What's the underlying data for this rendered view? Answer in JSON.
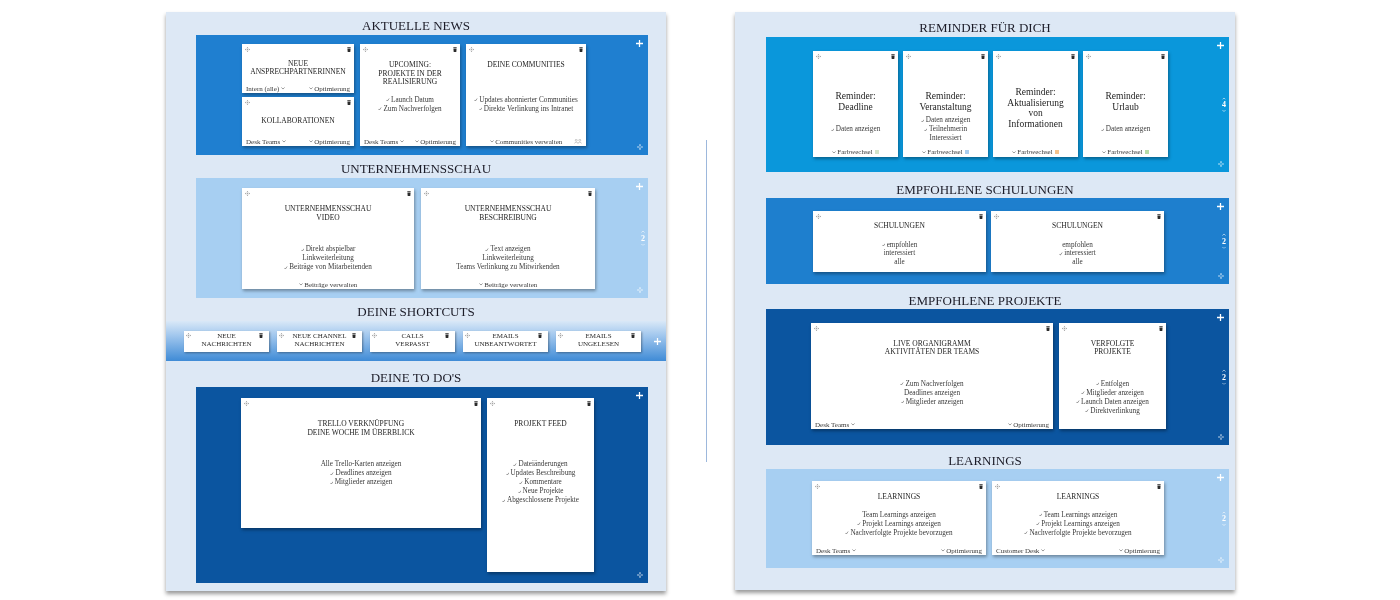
{
  "pages": [
    {
      "sections": [
        {
          "title": "AKTUELLE NEWS",
          "kind": "panel",
          "color": "#1f7fd0",
          "columns": [
            {
              "cards": [
                {
                  "title": "NEUE\nANSPRECHPARTNERINNEN",
                  "footer": {
                    "kind": "split",
                    "left": "Intern (alle)",
                    "right": "Optimierung"
                  }
                },
                {
                  "title": "KOLLABORATIONEN",
                  "footer": {
                    "kind": "split",
                    "left": "Desk Teams",
                    "right": "Optimierung"
                  }
                }
              ]
            },
            {
              "cards": [
                {
                  "title": "UPCOMING:\nPROJEKTE IN DER\nREALISIERUNG",
                  "options": [
                    {
                      "label": "Launch Datum",
                      "checked": true
                    },
                    {
                      "label": "Zum Nachverfolgen",
                      "checked": true
                    }
                  ],
                  "footer": {
                    "kind": "split",
                    "left": "Desk Teams",
                    "right": "Optimierung"
                  }
                }
              ]
            },
            {
              "cards": [
                {
                  "title": "DEINE COMMUNITIES",
                  "options": [
                    {
                      "label": "Updates abonnierter Communities",
                      "checked": true
                    },
                    {
                      "label": "Direkte Verlinkung ins Intranet",
                      "checked": true
                    }
                  ],
                  "footer": {
                    "kind": "members",
                    "center": "Communities verwalten"
                  }
                }
              ]
            }
          ]
        },
        {
          "title": "UNTERNEHMENSSCHAU",
          "kind": "panel",
          "color": "#a7cff2",
          "pager": "2",
          "columns": [
            {
              "cards": [
                {
                  "title": "UNTERNEHMENSSCHAU\nVIDEO",
                  "options": [
                    {
                      "label": "Direkt abspielbar",
                      "checked": true
                    },
                    {
                      "label": "Linkweiterleitung",
                      "checked": false
                    },
                    {
                      "label": "Beiträge von Mitarbeitenden",
                      "checked": true
                    }
                  ],
                  "footer": {
                    "kind": "action",
                    "center": "Beiträge verwalten"
                  }
                }
              ]
            },
            {
              "cards": [
                {
                  "title": "UNTERNEHMENSSCHAU\nBESCHREIBUNG",
                  "options": [
                    {
                      "label": "Text anzeigen",
                      "checked": true
                    },
                    {
                      "label": "Linkweiterleitung",
                      "checked": false
                    },
                    {
                      "label": "Teams Verlinkung zu Mitwirkenden",
                      "checked": false
                    }
                  ],
                  "footer": {
                    "kind": "action",
                    "center": "Beiträge verwalten"
                  }
                }
              ]
            }
          ]
        },
        {
          "title": "DEINE SHORTCUTS",
          "kind": "band",
          "columns": [
            {
              "cards": [
                {
                  "title": "NEUE\nNACHRICHTEN"
                }
              ]
            },
            {
              "cards": [
                {
                  "title": "NEUE CHANNEL\nNACHRICHTEN"
                }
              ]
            },
            {
              "cards": [
                {
                  "title": "CALLS\nVERPASST"
                }
              ]
            },
            {
              "cards": [
                {
                  "title": "EMAILS\nUNBEANTWORTET"
                }
              ]
            },
            {
              "cards": [
                {
                  "title": "EMAILS\nUNGELESEN"
                }
              ]
            }
          ]
        },
        {
          "title": "DEINE TO DO'S",
          "kind": "panel",
          "color": "#0b55a0",
          "columns": [
            {
              "cards": [
                {
                  "title": "TRELLO VERKNÜPFUNG\nDEINE WOCHE IM ÜBERBLICK",
                  "options": [
                    {
                      "label": "Alle Trello-Karten anzeigen",
                      "checked": false
                    },
                    {
                      "label": "Deadlines anzeigen",
                      "checked": true
                    },
                    {
                      "label": "Mitglieder anzeigen",
                      "checked": true
                    }
                  ]
                }
              ]
            },
            {
              "cards": [
                {
                  "title": "PROJEKT FEED",
                  "options": [
                    {
                      "label": "Dateiänderungen",
                      "checked": true
                    },
                    {
                      "label": "Updates Beschreibung",
                      "checked": true
                    },
                    {
                      "label": "Kommentare",
                      "checked": true
                    },
                    {
                      "label": "Neue Projekte",
                      "checked": true
                    },
                    {
                      "label": "Abgeschlossene Projekte",
                      "checked": true
                    }
                  ]
                }
              ]
            }
          ]
        }
      ]
    },
    {
      "sections": [
        {
          "title": "REMINDER FÜR DICH",
          "kind": "panel",
          "color": "#0a97db",
          "pager": "4",
          "columns": [
            {
              "cards": [
                {
                  "title": "Reminder:\nDeadline",
                  "options": [
                    {
                      "label": "Daten anzeigen",
                      "checked": true
                    }
                  ],
                  "footer": {
                    "kind": "swatch",
                    "center": "Farbwechsel",
                    "color": "#d3e3c9"
                  }
                }
              ]
            },
            {
              "cards": [
                {
                  "title": "Reminder:\nVeranstaltung",
                  "options": [
                    {
                      "label": "Daten anzeigen",
                      "checked": true
                    },
                    {
                      "label": "Teilnehmerin",
                      "checked": true
                    },
                    {
                      "label": "Interessiert",
                      "checked": false
                    }
                  ],
                  "footer": {
                    "kind": "swatch",
                    "center": "Farbwechsel",
                    "color": "#a9cdef"
                  }
                }
              ]
            },
            {
              "cards": [
                {
                  "title": "Reminder:\nAktualisierung\nvon\nInformationen",
                  "footer": {
                    "kind": "swatch",
                    "center": "Farbwechsel",
                    "color": "#f6c38c"
                  }
                }
              ]
            },
            {
              "cards": [
                {
                  "title": "Reminder:\nUrlaub",
                  "options": [
                    {
                      "label": "Daten anzeigen",
                      "checked": true
                    }
                  ],
                  "footer": {
                    "kind": "swatch",
                    "center": "Farbwechsel",
                    "color": "#b7dba6"
                  }
                }
              ]
            }
          ]
        },
        {
          "title": "EMPFOHLENE SCHULUNGEN",
          "kind": "panel",
          "color": "#1e7fce",
          "pager": "2",
          "columns": [
            {
              "cards": [
                {
                  "title": "SCHULUNGEN",
                  "options": [
                    {
                      "label": "empfohlen",
                      "checked": true
                    },
                    {
                      "label": "interessiert",
                      "checked": false
                    },
                    {
                      "label": "alle",
                      "checked": false
                    }
                  ]
                }
              ]
            },
            {
              "cards": [
                {
                  "title": "SCHULUNGEN",
                  "options": [
                    {
                      "label": "empfohlen",
                      "checked": false
                    },
                    {
                      "label": "interessiert",
                      "checked": true
                    },
                    {
                      "label": "alle",
                      "checked": false
                    }
                  ]
                }
              ]
            }
          ]
        },
        {
          "title": "EMPFOHLENE PROJEKTE",
          "kind": "panel",
          "color": "#0b55a0",
          "pager": "2",
          "columns": [
            {
              "cards": [
                {
                  "title": "LIVE ORGANIGRAMM\nAKTIVITÄTEN DER TEAMS",
                  "options": [
                    {
                      "label": "Zum Nachverfolgen",
                      "checked": true
                    },
                    {
                      "label": "Deadlines anzeigen",
                      "checked": false
                    },
                    {
                      "label": "Mitglieder anzeigen",
                      "checked": true
                    }
                  ],
                  "footer": {
                    "kind": "split",
                    "left": "Desk Teams",
                    "right": "Optimierung"
                  }
                }
              ]
            },
            {
              "cards": [
                {
                  "title": "VERFOLGTE\nPROJEKTE",
                  "options": [
                    {
                      "label": "Entfolgen",
                      "checked": true
                    },
                    {
                      "label": "Mitglieder anzeigen",
                      "checked": true
                    },
                    {
                      "label": "Launch Daten anzeigen",
                      "checked": true
                    },
                    {
                      "label": "Direktverlinkung",
                      "checked": true
                    }
                  ]
                }
              ]
            }
          ]
        },
        {
          "title": "LEARNINGS",
          "kind": "panel",
          "color": "#a7cff2",
          "pager": "2",
          "columns": [
            {
              "cards": [
                {
                  "title": "LEARNINGS",
                  "options": [
                    {
                      "label": "Team Learnings anzeigen",
                      "checked": false
                    },
                    {
                      "label": "Projekt Learnings anzeigen",
                      "checked": true
                    },
                    {
                      "label": "Nachverfolgte Projekte bevorzugen",
                      "checked": true
                    }
                  ],
                  "footer": {
                    "kind": "split",
                    "left": "Desk Teams",
                    "right": "Optimierung"
                  }
                }
              ]
            },
            {
              "cards": [
                {
                  "title": "LEARNINGS",
                  "options": [
                    {
                      "label": "Team Learnings anzeigen",
                      "checked": true
                    },
                    {
                      "label": "Projekt Learnings anzeigen",
                      "checked": true
                    },
                    {
                      "label": "Nachverfolgte Projekte bevorzugen",
                      "checked": true
                    }
                  ],
                  "footer": {
                    "kind": "split",
                    "left": "Customer Desk",
                    "right": "Optimierung"
                  }
                }
              ]
            }
          ]
        }
      ]
    }
  ]
}
